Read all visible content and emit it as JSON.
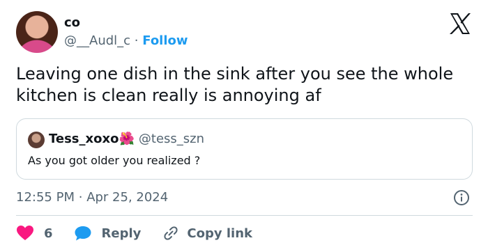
{
  "author": {
    "name": "co",
    "handle": "@__Audl_c",
    "separator": "·",
    "follow_label": "Follow"
  },
  "tweet": {
    "text": "Leaving one dish in the sink after you see the whole kitchen is clean really is annoying af"
  },
  "quoted": {
    "name": "Tess_xoxo",
    "emoji": "🌺",
    "handle": "@tess_szn",
    "text": "As you got older you realized ?"
  },
  "meta": {
    "time": "12:55 PM",
    "separator": "·",
    "date": "Apr 25, 2024"
  },
  "actions": {
    "like_count": "6",
    "reply_label": "Reply",
    "copy_label": "Copy link"
  },
  "colors": {
    "accent": "#1d9bf0",
    "like": "#f91880",
    "muted": "#536471",
    "border": "#cfd9de"
  },
  "icons": [
    "x-logo-icon",
    "info-icon",
    "heart-icon",
    "reply-bubble-icon",
    "link-icon"
  ]
}
